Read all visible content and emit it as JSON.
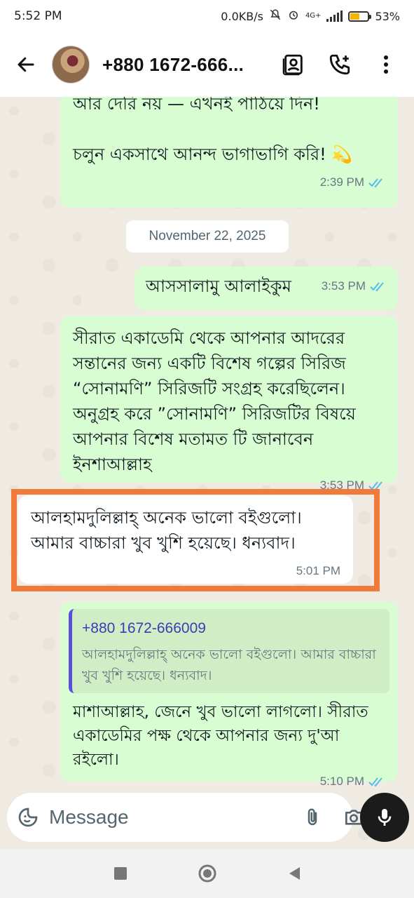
{
  "status_bar": {
    "time": "5:52 PM",
    "network_speed": "0.0KB/s",
    "network_type": "4G+",
    "battery": "53%",
    "battery_level": 0.53
  },
  "header": {
    "contact_name": "+880 1672-666...",
    "icons": [
      "back-arrow-icon",
      "avatar",
      "contact-card-icon",
      "add-call-icon",
      "more-vert-icon"
    ]
  },
  "messages": [
    {
      "direction": "outgoing",
      "partial_text": "আর দেরি নয় — এখনই পাঠিয়ে দিন!",
      "text": "চলুন একসাথে আনন্দ ভাগাভাগি করি! 💫",
      "time": "2:39 PM",
      "status": "read"
    },
    {
      "direction": "outgoing",
      "text": "আসসালামু আলাইকুম",
      "time": "3:53 PM",
      "status": "read"
    },
    {
      "direction": "outgoing",
      "text": "সীরাত একাডেমি থেকে আপনার আদরের সন্তানের জন্য একটি বিশেষ গল্পের সিরিজ “সোনামণি” সিরিজটি সংগ্রহ করেছিলেন। অনুগ্রহ করে ”সোনামণি” সিরিজটির বিষয়ে আপনার বিশেষ মতামত টি জানাবেন ইনশাআল্লাহ",
      "time": "3:53 PM",
      "status": "read"
    },
    {
      "direction": "incoming",
      "text": "আলহামদুলিল্লাহ্ অনেক ভালো বইগুলো। আমার বাচ্চারা খুব খুশি হয়েছে। ধন্যবাদ।",
      "time": "5:01 PM"
    },
    {
      "direction": "outgoing",
      "quote": {
        "name": "+880 1672-666009",
        "text": "আলহামদুলিল্লাহ্ অনেক ভালো বইগুলো। আমার বাচ্চারা খুব খুশি হয়েছে। ধন্যবাদ।"
      },
      "text": "মাশাআল্লাহ, জেনে খুব ভালো লাগলো। সীরাত একাডেমির পক্ষ থেকে আপনার জন্য দু'আ রইলো।",
      "time": "5:10 PM",
      "status": "read"
    }
  ],
  "date_separator": "November 22, 2025",
  "input": {
    "placeholder": "Message"
  },
  "colors": {
    "outgoing_bubble": "#d9fdd3",
    "incoming_bubble": "#ffffff",
    "chat_background": "#efeae2",
    "read_tick": "#53bdeb",
    "highlight_border": "#f07a3a",
    "quote_accent": "#5b4fd6"
  }
}
